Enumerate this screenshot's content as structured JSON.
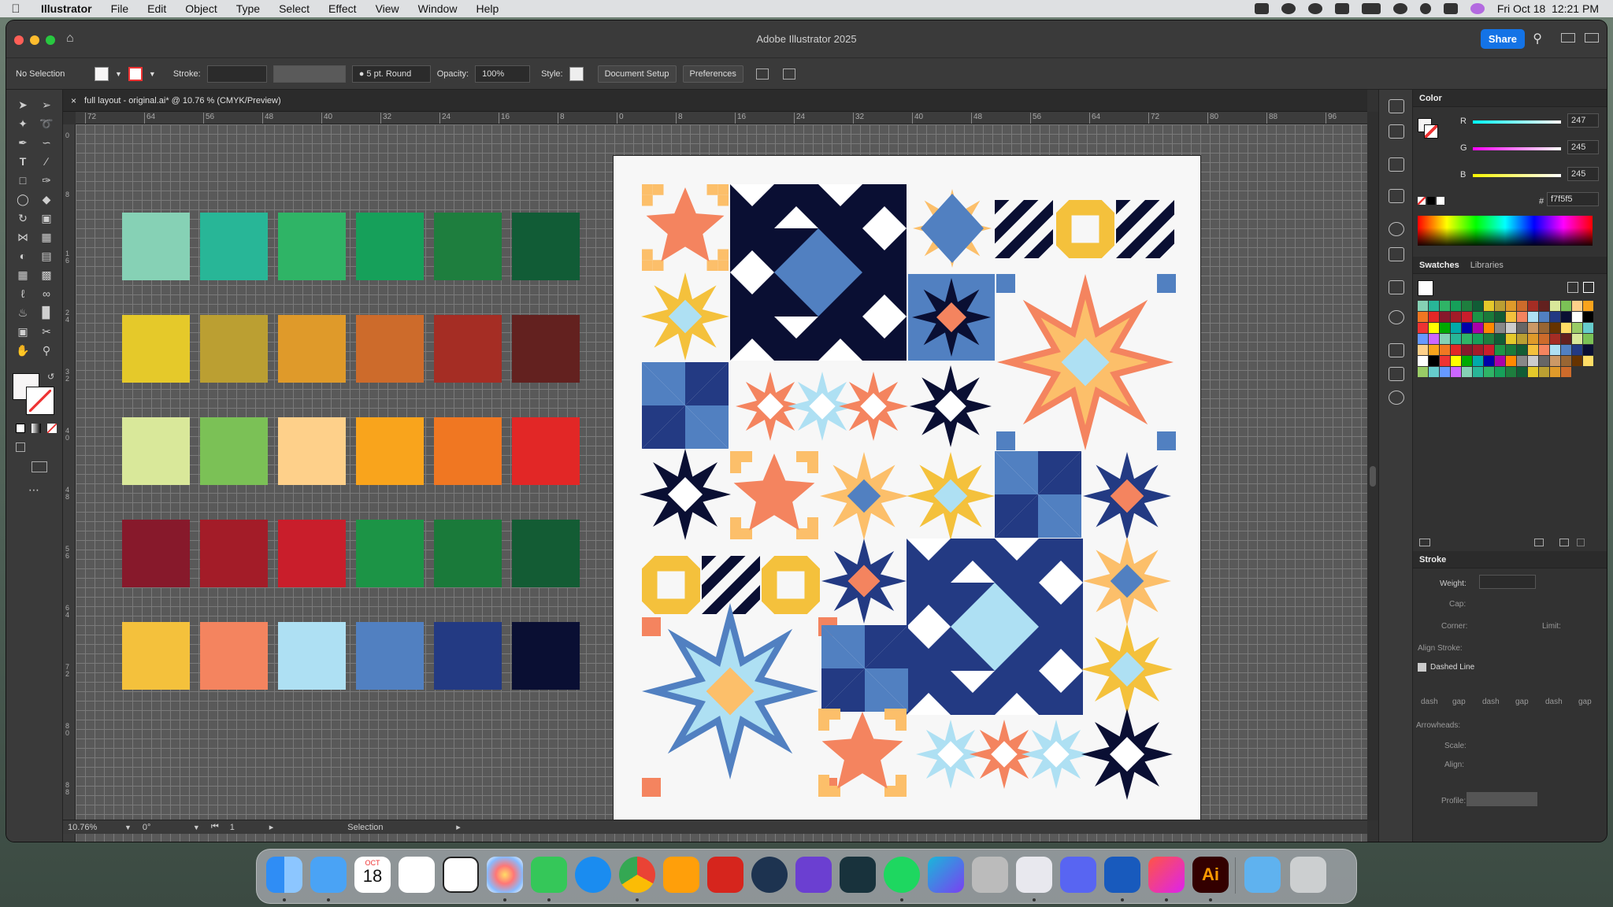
{
  "menubar": {
    "app_name": "Illustrator",
    "items": [
      "File",
      "Edit",
      "Object",
      "Type",
      "Select",
      "Effect",
      "View",
      "Window",
      "Help"
    ],
    "datetime": "Fri Oct 18  12:21 PM"
  },
  "window": {
    "title": "Adobe Illustrator 2025",
    "share_label": "Share"
  },
  "control_bar": {
    "selection": "No Selection",
    "stroke_label": "Stroke:",
    "brush": "5 pt. Round",
    "opacity_label": "Opacity:",
    "opacity_value": "100%",
    "style_label": "Style:",
    "document_setup": "Document Setup",
    "preferences": "Preferences"
  },
  "document": {
    "tab_title": "full layout - original.ai* @ 10.76 % (CMYK/Preview)",
    "ruler_h": [
      "72",
      "64",
      "56",
      "48",
      "40",
      "32",
      "24",
      "16",
      "8",
      "0",
      "8",
      "16",
      "24",
      "32",
      "40",
      "48",
      "56",
      "64",
      "72",
      "80",
      "88",
      "96"
    ],
    "ruler_v": [
      "0",
      "8",
      "1 6",
      "2 4",
      "3 2",
      "4 0",
      "4 8",
      "5 6",
      "6 4",
      "7 2",
      "8 0",
      "8 8"
    ]
  },
  "swatch_palette": [
    [
      "#86d1b5",
      "#28b697",
      "#2fb466",
      "#16a05a",
      "#1e7e3e",
      "#115c36"
    ],
    [
      "#e5c92a",
      "#bb9f32",
      "#df9a2a",
      "#cd6b2b",
      "#a52d24",
      "#63211f"
    ],
    [
      "#d9e89a",
      "#7bc156",
      "#fed08a",
      "#f9a41c",
      "#f07722",
      "#e22726"
    ],
    [
      "#87192b",
      "#a31c28",
      "#c91e2b",
      "#1c9446",
      "#1a7a3a",
      "#135c34"
    ],
    [
      "#f4c13c",
      "#f4845f",
      "#aee0f3",
      "#5180c1",
      "#233a83",
      "#0a0f33"
    ]
  ],
  "status_bar": {
    "zoom": "10.76%",
    "rotation": "0°",
    "artboard_num": "1",
    "tool": "Selection"
  },
  "color_panel": {
    "title": "Color",
    "r_label": "R",
    "r_value": "247",
    "g_label": "G",
    "g_value": "245",
    "b_label": "B",
    "b_value": "245",
    "hex_label": "#",
    "hex_value": "f7f5f5"
  },
  "swatches_panel": {
    "tab_swatches": "Swatches",
    "tab_libraries": "Libraries"
  },
  "stroke_panel": {
    "title": "Stroke",
    "weight_label": "Weight:",
    "cap_label": "Cap:",
    "corner_label": "Corner:",
    "limit_label": "Limit:",
    "align_label": "Align Stroke:",
    "dashed_label": "Dashed Line",
    "dash_labels": [
      "dash",
      "gap",
      "dash",
      "gap",
      "dash",
      "gap"
    ],
    "arrowheads_label": "Arrowheads:",
    "scale_label": "Scale:",
    "align2_label": "Align:",
    "profile_label": "Profile:"
  },
  "dock": {
    "calendar_month": "OCT",
    "calendar_day": "18",
    "ai_label": "Ai"
  },
  "colors": {
    "accent": "#1473e6",
    "navy": "#0a0f33",
    "blue": "#5180c1",
    "deepblue": "#233a83",
    "lightblue": "#aee0f3",
    "coral": "#f4845f",
    "yellow": "#f4c13c",
    "peach": "#fcbf6a"
  }
}
